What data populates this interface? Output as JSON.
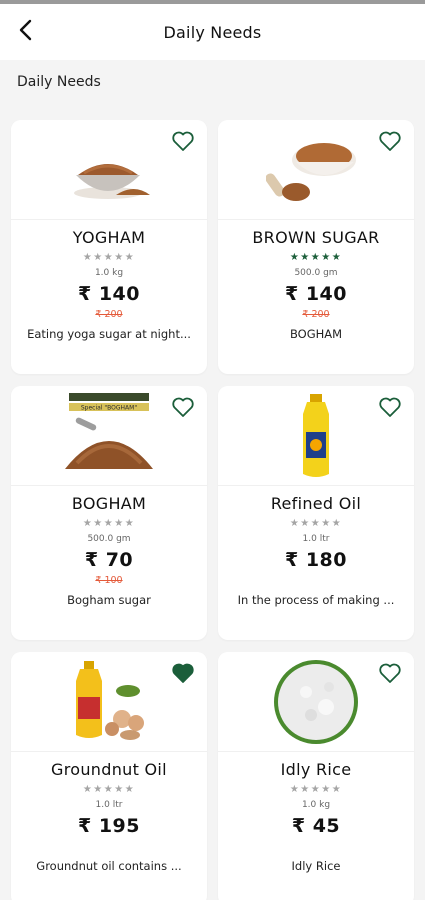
{
  "header": {
    "title": "Daily Needs"
  },
  "section": {
    "title": "Daily Needs"
  },
  "colors": {
    "accent": "#1b5e3a",
    "mrp": "#e45a3a"
  },
  "products": [
    {
      "name": "YOGHAM",
      "rating": 0,
      "qty": "1.0 kg",
      "price": "₹ 140",
      "mrp": "₹ 200",
      "desc": "Eating yoga sugar at night...",
      "favorite": false,
      "image_icon": "sugar-bowl-icon"
    },
    {
      "name": "BROWN SUGAR",
      "rating": 5,
      "qty": "500.0 gm",
      "price": "₹ 140",
      "mrp": "₹ 200",
      "desc": "BOGHAM",
      "favorite": false,
      "image_icon": "sugar-bowl-scoop-icon"
    },
    {
      "name": "BOGHAM",
      "rating": 0,
      "qty": "500.0 gm",
      "price": "₹ 70",
      "mrp": "₹ 100",
      "desc": "Bogham sugar",
      "favorite": false,
      "image_icon": "sugar-pile-icon",
      "label": "Special \"BOGHAM\""
    },
    {
      "name": "Refined Oil",
      "rating": 0,
      "qty": "1.0 ltr",
      "price": "₹ 180",
      "mrp": "",
      "desc": "In the process of making ...",
      "favorite": false,
      "image_icon": "oil-bottle-icon"
    },
    {
      "name": "Groundnut Oil",
      "rating": 0,
      "qty": "1.0 ltr",
      "price": "₹ 195",
      "mrp": "",
      "desc": "Groundnut oil contains ...",
      "favorite": true,
      "image_icon": "groundnut-oil-icon"
    },
    {
      "name": "Idly Rice",
      "rating": 0,
      "qty": "1.0 kg",
      "price": "₹ 45",
      "mrp": "",
      "desc": "Idly Rice",
      "favorite": false,
      "image_icon": "rice-bowl-icon"
    }
  ]
}
